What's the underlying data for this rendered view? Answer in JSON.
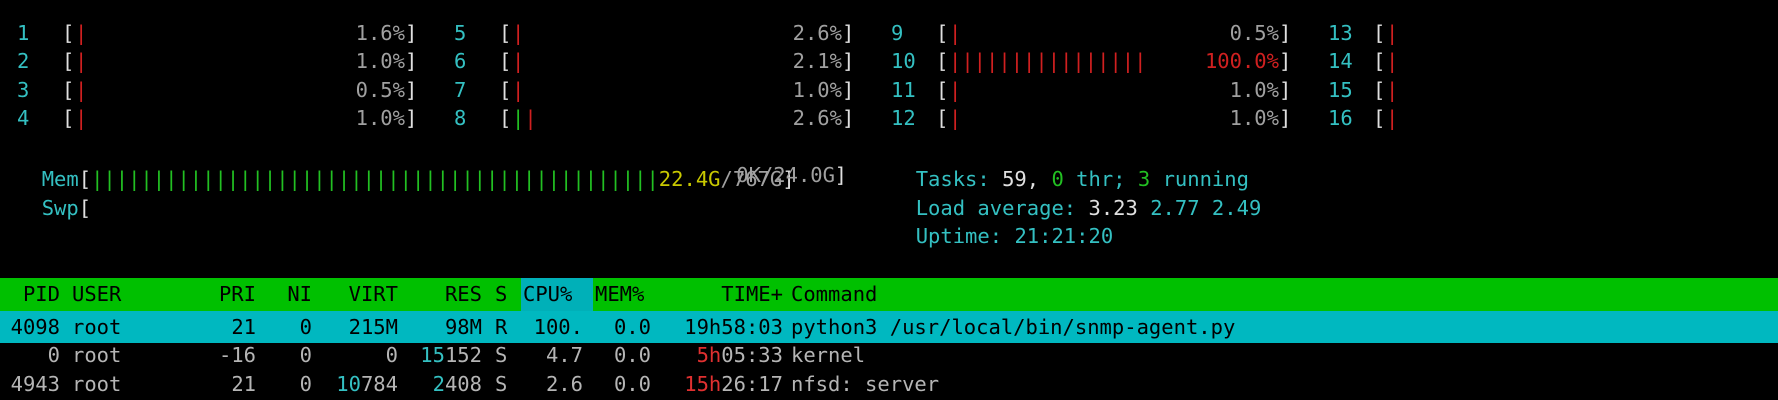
{
  "cpus": [
    {
      "id": "1",
      "pct": "1.6%",
      "bars": [
        {
          "text": "|",
          "color": "red"
        }
      ]
    },
    {
      "id": "2",
      "pct": "1.0%",
      "bars": [
        {
          "text": "|",
          "color": "red"
        }
      ]
    },
    {
      "id": "3",
      "pct": "0.5%",
      "bars": [
        {
          "text": "|",
          "color": "red"
        }
      ]
    },
    {
      "id": "4",
      "pct": "1.0%",
      "bars": [
        {
          "text": "|",
          "color": "red"
        }
      ]
    },
    {
      "id": "5",
      "pct": "2.6%",
      "bars": [
        {
          "text": "|",
          "color": "red"
        }
      ]
    },
    {
      "id": "6",
      "pct": "2.1%",
      "bars": [
        {
          "text": "|",
          "color": "red"
        }
      ]
    },
    {
      "id": "7",
      "pct": "1.0%",
      "bars": [
        {
          "text": "|",
          "color": "red"
        }
      ]
    },
    {
      "id": "8",
      "pct": "2.6%",
      "bars": [
        {
          "text": "|",
          "color": "green"
        },
        {
          "text": "|",
          "color": "red"
        }
      ]
    },
    {
      "id": "9",
      "pct": "0.5%",
      "bars": [
        {
          "text": "|",
          "color": "red"
        }
      ]
    },
    {
      "id": "10",
      "pct": "100.0%",
      "bars": [
        {
          "text": "||||||||||||||||",
          "color": "red"
        }
      ]
    },
    {
      "id": "11",
      "pct": "1.0%",
      "bars": [
        {
          "text": "|",
          "color": "red"
        }
      ]
    },
    {
      "id": "12",
      "pct": "1.0%",
      "bars": [
        {
          "text": "|",
          "color": "red"
        }
      ]
    },
    {
      "id": "13",
      "pct": "",
      "bars": [
        {
          "text": "|",
          "color": "red"
        }
      ]
    },
    {
      "id": "14",
      "pct": "",
      "bars": [
        {
          "text": "|",
          "color": "red"
        }
      ]
    },
    {
      "id": "15",
      "pct": "",
      "bars": [
        {
          "text": "|",
          "color": "red"
        }
      ]
    },
    {
      "id": "16",
      "pct": "",
      "bars": [
        {
          "text": "|",
          "color": "red"
        }
      ]
    }
  ],
  "mem": {
    "label": "Mem",
    "bar": "||||||||||||||||||||||||||||||||||||||||||||||",
    "used": "22.4G",
    "total": "/767G"
  },
  "swp": {
    "label": "Swp",
    "value": "0K/24.0G"
  },
  "tasks": {
    "label": "Tasks:",
    "count": "59,",
    "thr": "0",
    "thr_label": "thr;",
    "running": "3",
    "running_label": "running"
  },
  "load": {
    "label": "Load average:",
    "one": "3.23",
    "five": "2.77",
    "fifteen": "2.49"
  },
  "uptime": {
    "label": "Uptime:",
    "value": "21:21:20"
  },
  "header": {
    "pid": "PID",
    "user": "USER",
    "pri": "PRI",
    "ni": "NI",
    "virt": "VIRT",
    "res": "RES",
    "s": "S",
    "cpu": "CPU%",
    "mem": "MEM%",
    "time": "TIME+",
    "command": "Command"
  },
  "processes": [
    {
      "pid": "4098",
      "user": "root",
      "pri": "21",
      "ni": "0",
      "virt": "215M",
      "res": "98M",
      "s": "R",
      "cpu": "100.",
      "mem": "0.0",
      "time_hi": "19h",
      "time_lo": "58:03",
      "command": "python3 /usr/local/bin/snmp-agent.py",
      "selected": true,
      "virt_hi": "",
      "virt_lo": "215M",
      "res_hi": "",
      "res_lo": "98M"
    },
    {
      "pid": "0",
      "user": "root",
      "pri": "-16",
      "ni": "0",
      "virt": "0",
      "res": "15152",
      "s": "S",
      "cpu": "4.7",
      "mem": "0.0",
      "time_hi": "5h",
      "time_lo": "05:33",
      "command": "kernel",
      "selected": false,
      "virt_hi": "",
      "virt_lo": "0",
      "res_hi": "15",
      "res_lo": "152"
    },
    {
      "pid": "4943",
      "user": "root",
      "pri": "21",
      "ni": "0",
      "virt": "10784",
      "res": "2408",
      "s": "S",
      "cpu": "2.6",
      "mem": "0.0",
      "time_hi": "15h",
      "time_lo": "26:17",
      "command": "nfsd: server",
      "selected": false,
      "virt_hi": "10",
      "virt_lo": "784",
      "res_hi": "2",
      "res_lo": "408"
    }
  ],
  "colors": {
    "background": "#000000",
    "header_bg": "#00c000",
    "selected_bg": "#00b8c0",
    "cyan": "#34c0c2",
    "red": "#d02020",
    "green": "#22c022",
    "yellow": "#c9c900"
  }
}
